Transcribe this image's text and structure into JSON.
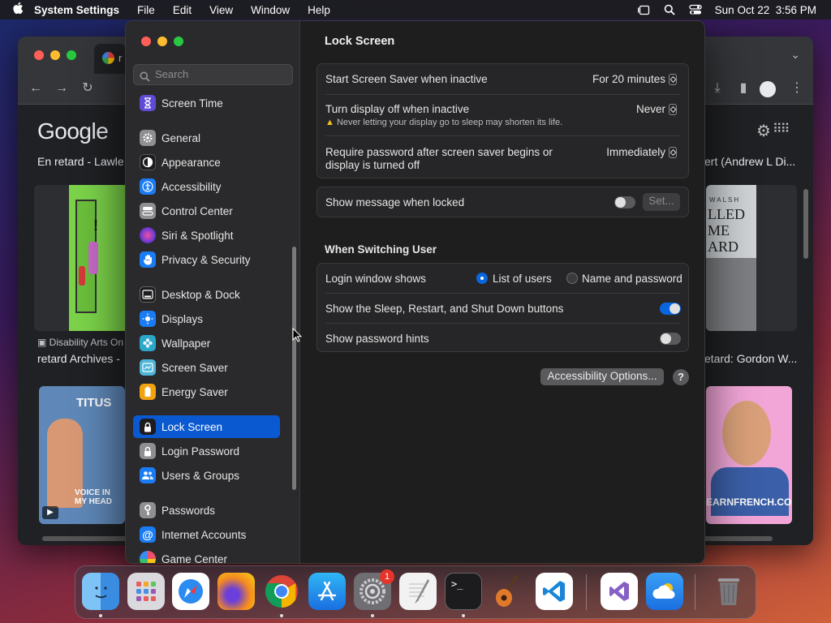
{
  "menubar": {
    "app_name": "System Settings",
    "menus": [
      "File",
      "Edit",
      "View",
      "Window",
      "Help"
    ],
    "datetime": "Sun Oct 22  3:56 PM"
  },
  "browser": {
    "tab_title": "r",
    "logo": "Google",
    "results": {
      "left_title": "En retard - Lawle",
      "right_title": "ert (Andrew L Di...",
      "left_source": "Disability Arts On",
      "left_caption": "retard Archives -",
      "right_caption": "etard: Gordon W...",
      "book_title": "TITUS",
      "book_subtitle": "VOICE IN MY HEAD",
      "right_book_text": "LLED ME ARD",
      "right_book_header": "WALSH",
      "french_text": "EARNFRENCH.COM"
    }
  },
  "settings": {
    "search_placeholder": "Search",
    "sidebar": [
      {
        "label": "Screen Time",
        "icon": "hourglass-icon",
        "color": "#5e4bd6"
      },
      {
        "label": "General",
        "icon": "gear-icon",
        "color": "#8e8e93"
      },
      {
        "label": "Appearance",
        "icon": "appearance-icon",
        "color": "#1c1c1e"
      },
      {
        "label": "Accessibility",
        "icon": "accessibility-icon",
        "color": "#1a7cf5"
      },
      {
        "label": "Control Center",
        "icon": "control-center-icon",
        "color": "#8e8e93"
      },
      {
        "label": "Siri & Spotlight",
        "icon": "siri-icon",
        "color": "#b43cc9"
      },
      {
        "label": "Privacy & Security",
        "icon": "hand-icon",
        "color": "#1a7cf5"
      },
      {
        "label": "Desktop & Dock",
        "icon": "dock-icon",
        "color": "#1c1c1e"
      },
      {
        "label": "Displays",
        "icon": "sun-icon",
        "color": "#1a7cf5"
      },
      {
        "label": "Wallpaper",
        "icon": "flower-icon",
        "color": "#2aa7c9"
      },
      {
        "label": "Screen Saver",
        "icon": "screen-saver-icon",
        "color": "#4fb6d9"
      },
      {
        "label": "Energy Saver",
        "icon": "battery-icon",
        "color": "#f2a30f"
      },
      {
        "label": "Lock Screen",
        "icon": "lock-icon",
        "color": "#1c1c1e"
      },
      {
        "label": "Login Password",
        "icon": "lock-icon",
        "color": "#8e8e93"
      },
      {
        "label": "Users & Groups",
        "icon": "users-icon",
        "color": "#1a7cf5"
      },
      {
        "label": "Passwords",
        "icon": "key-icon",
        "color": "#8e8e93"
      },
      {
        "label": "Internet Accounts",
        "icon": "at-icon",
        "color": "#1a7cf5"
      },
      {
        "label": "Game Center",
        "icon": "game-center-icon",
        "color": "#e0e0e0"
      }
    ],
    "page_title": "Lock Screen",
    "screensaver": {
      "label": "Start Screen Saver when inactive",
      "value": "For 20 minutes"
    },
    "display_off": {
      "label": "Turn display off when inactive",
      "value": "Never",
      "warning": "Never letting your display go to sleep may shorten its life."
    },
    "require_password": {
      "label_line1": "Require password after screen saver begins or",
      "label_line2": "display is turned off",
      "value": "Immediately"
    },
    "show_message": {
      "label": "Show message when locked",
      "button": "Set...",
      "on": false
    },
    "switching_title": "When Switching User",
    "login_window": {
      "label": "Login window shows",
      "option1": "List of users",
      "option2": "Name and password",
      "selected": "List of users"
    },
    "sleep_buttons": {
      "label": "Show the Sleep, Restart, and Shut Down buttons",
      "on": true
    },
    "password_hints": {
      "label": "Show password hints",
      "on": false
    },
    "accessibility_button": "Accessibility Options...",
    "help_label": "?"
  },
  "dock": {
    "settings_badge": "1"
  },
  "colors": {
    "accent": "#0a59d0",
    "toggle_on": "#0a66e0",
    "warning": "#f5c518"
  }
}
